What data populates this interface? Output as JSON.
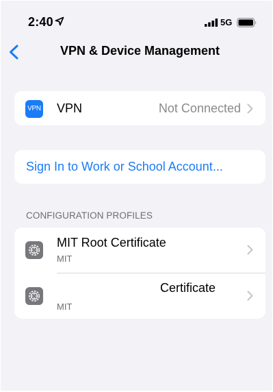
{
  "status_bar": {
    "time": "2:40",
    "network": "5G",
    "icons": [
      "location-arrow-icon",
      "signal-bars-icon",
      "battery-icon"
    ]
  },
  "nav": {
    "back_icon": "chevron-left-icon",
    "title": "VPN & Device Management"
  },
  "vpn_row": {
    "badge_text": "VPN",
    "label": "VPN",
    "status": "Not Connected"
  },
  "sign_in": {
    "label": "Sign In to Work or School Account..."
  },
  "profiles_section": {
    "header": "CONFIGURATION PROFILES",
    "items": [
      {
        "title": "MIT Root Certificate",
        "subtitle": "MIT",
        "icon": "gear-icon"
      },
      {
        "title": "Certificate",
        "subtitle": "MIT",
        "icon": "gear-icon"
      }
    ]
  },
  "colors": {
    "accent": "#1a7cf6",
    "background": "#f2f2f7",
    "secondary_text": "#8a8a8e"
  }
}
